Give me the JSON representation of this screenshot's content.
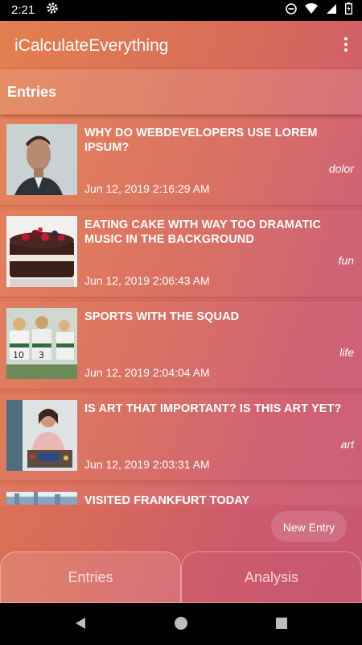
{
  "status_bar": {
    "time": "2:21",
    "icons": [
      "gear-icon",
      "do-not-disturb-icon",
      "wifi-icon",
      "signal-icon",
      "battery-icon"
    ]
  },
  "app_bar": {
    "title": "iCalculateEverything",
    "overflow_icon": "more-vert-icon"
  },
  "section": {
    "title": "Entries"
  },
  "entries": [
    {
      "title": "Why do webdevelopers use lorem ipsum?",
      "tag": "dolor",
      "date": "Jun 12, 2019 2:16:29 AM",
      "thumb": "portrait-photo"
    },
    {
      "title": "Eating cake with way too dramatic music in the background",
      "tag": "fun",
      "date": "Jun 12, 2019 2:06:43 AM",
      "thumb": "cake-photo"
    },
    {
      "title": "Sports with the squad",
      "tag": "life",
      "date": "Jun 12, 2019 2:04:04 AM",
      "thumb": "sports-team-photo"
    },
    {
      "title": "Is art that important? Is this art yet?",
      "tag": "art",
      "date": "Jun 12, 2019 2:03:31 AM",
      "thumb": "painting-photo"
    },
    {
      "title": "Visited Frankfurt today",
      "thumb": "city-skyline-photo"
    }
  ],
  "fab": {
    "label": "New Entry"
  },
  "bottom_tabs": [
    {
      "label": "Entries",
      "selected": true
    },
    {
      "label": "Analysis",
      "selected": false
    }
  ],
  "nav_bar": {
    "icons": [
      "back-icon",
      "home-icon",
      "recents-icon"
    ]
  },
  "colors": {
    "gradient_start": "#e3804f",
    "gradient_end": "#c7576f",
    "text": "#ffffff"
  }
}
